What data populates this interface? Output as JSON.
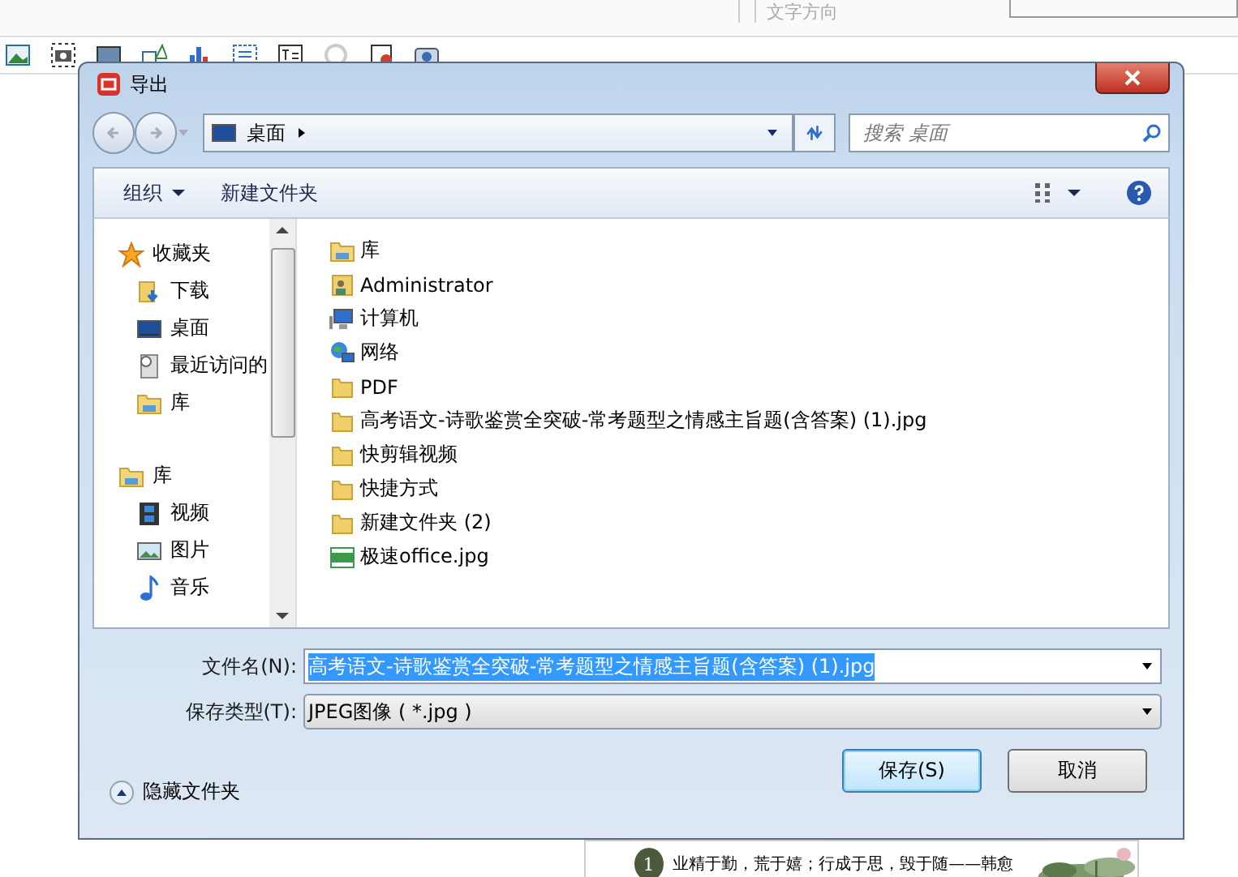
{
  "app_toolbar": {
    "text_direction": "文字方向"
  },
  "dialog": {
    "title": "导出",
    "address": {
      "location": "桌面",
      "search_placeholder": "搜索 桌面"
    },
    "toolbar": {
      "organize": "组织",
      "new_folder": "新建文件夹"
    },
    "nav": [
      {
        "label": "收藏夹",
        "kind": "favorites",
        "children": [
          {
            "label": "下载",
            "kind": "downloads"
          },
          {
            "label": "桌面",
            "kind": "desktop"
          },
          {
            "label": "最近访问的",
            "kind": "recent"
          },
          {
            "label": "库",
            "kind": "library"
          }
        ]
      },
      {
        "label": "库",
        "kind": "library",
        "children": [
          {
            "label": "视频",
            "kind": "video"
          },
          {
            "label": "图片",
            "kind": "pictures"
          },
          {
            "label": "音乐",
            "kind": "music"
          }
        ]
      }
    ],
    "files": [
      {
        "name": "库",
        "kind": "library"
      },
      {
        "name": "Administrator",
        "kind": "user"
      },
      {
        "name": "计算机",
        "kind": "computer"
      },
      {
        "name": "网络",
        "kind": "network"
      },
      {
        "name": "PDF",
        "kind": "folder"
      },
      {
        "name": "高考语文-诗歌鉴赏全突破-常考题型之情感主旨题(含答案) (1).jpg",
        "kind": "folder"
      },
      {
        "name": "快剪辑视频",
        "kind": "folder"
      },
      {
        "name": "快捷方式",
        "kind": "folder"
      },
      {
        "name": "新建文件夹 (2)",
        "kind": "folder"
      },
      {
        "name": "极速office.jpg",
        "kind": "jpg"
      }
    ],
    "filename": {
      "label": "文件名(N):",
      "value": "高考语文-诗歌鉴赏全突破-常考题型之情感主旨题(含答案) (1).jpg",
      "text_selected": true
    },
    "filetype": {
      "label": "保存类型(T):",
      "value": "JPEG图像 ( *.jpg )"
    },
    "hide_folders": "隐藏文件夹",
    "buttons": [
      {
        "label": "保存(S)",
        "default": true
      },
      {
        "label": "取消",
        "default": false
      }
    ]
  },
  "document": {
    "number": "1",
    "quote": "业精于勤，荒于嬉；行成于思，毁于随——韩愈"
  }
}
